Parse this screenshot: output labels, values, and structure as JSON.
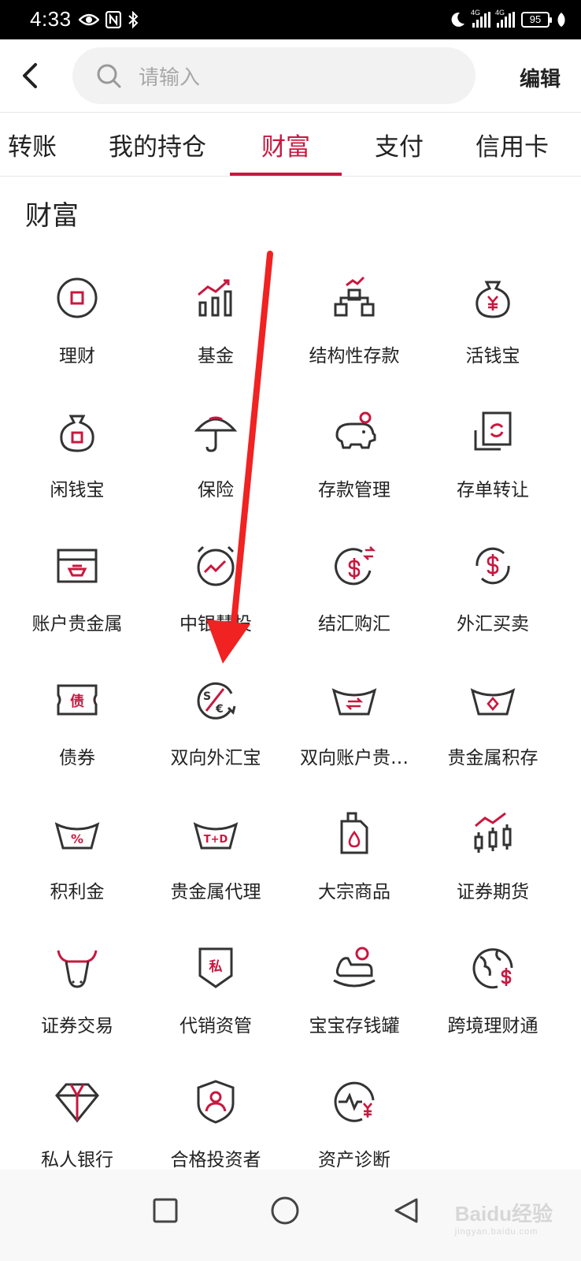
{
  "status_bar": {
    "time": "4:33",
    "battery": "95",
    "network_1": "4G",
    "network_2": "4G"
  },
  "header": {
    "search_placeholder": "请输入",
    "edit_label": "编辑"
  },
  "tabs": [
    {
      "label": "转账",
      "active": false
    },
    {
      "label": "我的持仓",
      "active": false
    },
    {
      "label": "财富",
      "active": true
    },
    {
      "label": "支付",
      "active": false
    },
    {
      "label": "信用卡",
      "active": false
    }
  ],
  "section_title": "财富",
  "accent_color": "#c8183f",
  "items": [
    {
      "label": "理财",
      "icon": "coin-square-icon"
    },
    {
      "label": "基金",
      "icon": "bar-chart-up-icon"
    },
    {
      "label": "结构性存款",
      "icon": "structure-chart-icon"
    },
    {
      "label": "活钱宝",
      "icon": "yen-money-bag-icon"
    },
    {
      "label": "闲钱宝",
      "icon": "money-bag-icon"
    },
    {
      "label": "保险",
      "icon": "umbrella-icon"
    },
    {
      "label": "存款管理",
      "icon": "piggy-bank-icon"
    },
    {
      "label": "存单转让",
      "icon": "certificate-transfer-icon"
    },
    {
      "label": "账户贵金属",
      "icon": "gold-bar-box-icon"
    },
    {
      "label": "中银慧投",
      "icon": "stopwatch-trend-icon"
    },
    {
      "label": "结汇购汇",
      "icon": "dollar-exchange-icon"
    },
    {
      "label": "外汇买卖",
      "icon": "dollar-cycle-icon"
    },
    {
      "label": "债券",
      "icon": "bond-ticket-icon"
    },
    {
      "label": "双向外汇宝",
      "icon": "dollar-euro-icon"
    },
    {
      "label": "双向账户贵…",
      "icon": "gold-ingot-exchange-icon"
    },
    {
      "label": "贵金属积存",
      "icon": "gold-ingot-diamond-icon"
    },
    {
      "label": "积利金",
      "icon": "gold-ingot-percent-icon"
    },
    {
      "label": "贵金属代理",
      "icon": "gold-ingot-td-icon"
    },
    {
      "label": "大宗商品",
      "icon": "oil-can-icon"
    },
    {
      "label": "证券期货",
      "icon": "candlestick-chart-icon"
    },
    {
      "label": "证券交易",
      "icon": "bull-icon"
    },
    {
      "label": "代销资管",
      "icon": "private-shield-icon"
    },
    {
      "label": "宝宝存钱罐",
      "icon": "rocking-horse-icon"
    },
    {
      "label": "跨境理财通",
      "icon": "globe-dollar-icon"
    },
    {
      "label": "私人银行",
      "icon": "diamond-icon"
    },
    {
      "label": "合格投资者",
      "icon": "shield-user-icon"
    },
    {
      "label": "资产诊断",
      "icon": "pulse-yen-icon"
    }
  ],
  "bond_badge": "债",
  "private_badge": "私",
  "percent_badge": "%",
  "td_badge": "T+D",
  "watermark": {
    "brand": "Baidu经验",
    "url": "jingyan.baidu.com"
  }
}
